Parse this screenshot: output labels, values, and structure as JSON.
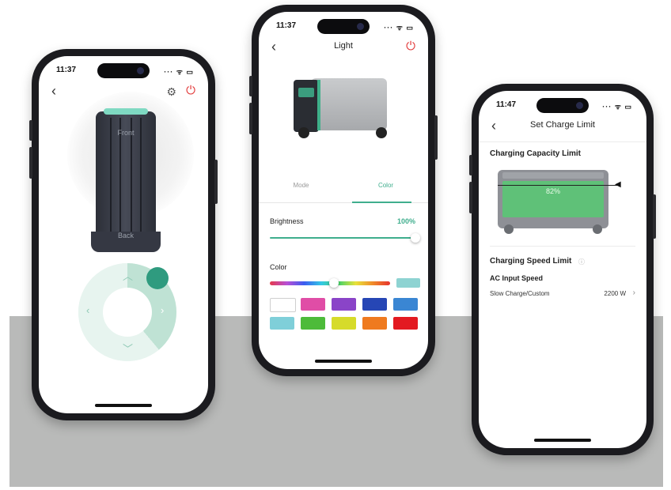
{
  "phone1": {
    "time": "11:37",
    "device_front_label": "Front",
    "device_back_label": "Back",
    "icons": [
      "back-icon",
      "gear-icon",
      "power-icon",
      "chevron-up-icon",
      "chevron-right-icon",
      "chevron-down-icon",
      "chevron-left-icon"
    ]
  },
  "phone2": {
    "time": "11:37",
    "title": "Light",
    "tabs": [
      {
        "label": "Mode",
        "active": false
      },
      {
        "label": "Color",
        "active": true
      }
    ],
    "brightness_label": "Brightness",
    "brightness_value": "100%",
    "brightness_level": 1.0,
    "color_label": "Color",
    "hue_position": 0.53,
    "selected_color": "#8ed3d2",
    "swatches": [
      "#ffffff",
      "#e04da6",
      "#8a44c8",
      "#2646b5",
      "#3a86d3",
      "#7fcfd9",
      "#4dbb3a",
      "#d6db2a",
      "#ef7a1f",
      "#e31a21"
    ]
  },
  "phone3": {
    "time": "11:47",
    "title": "Set Charge Limit",
    "capacity_title": "Charging Capacity Limit",
    "battery_percent": "82%",
    "speed_title": "Charging Speed Limit",
    "ac_input_label": "AC Input Speed",
    "mode_label": "Slow Charge/Custom",
    "mode_value": "2200 W"
  },
  "colors": {
    "accent": "#3fae8d",
    "power": "#e23a3a",
    "battery_fill": "#5fc178",
    "backdrop": "#b9bab9"
  }
}
